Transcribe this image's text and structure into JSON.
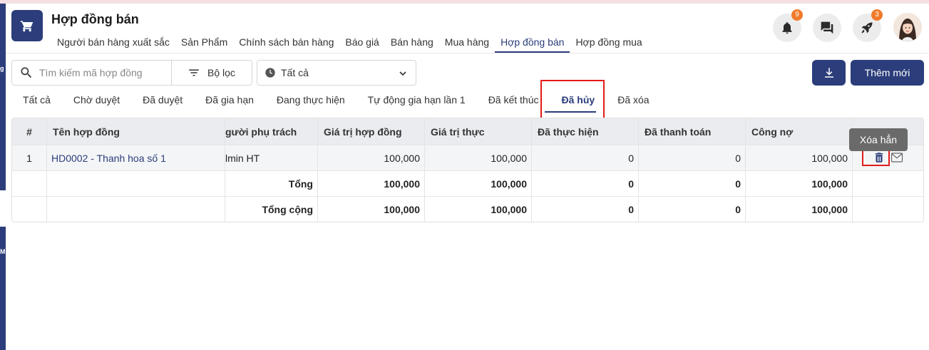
{
  "app": {
    "title": "Hợp đồng bán",
    "icon": "cart-icon"
  },
  "nav": {
    "items": [
      {
        "label": "Người bán hàng xuất sắc"
      },
      {
        "label": "Sản Phẩm"
      },
      {
        "label": "Chính sách bán hàng"
      },
      {
        "label": "Báo giá"
      },
      {
        "label": "Bán hàng"
      },
      {
        "label": "Mua hàng"
      },
      {
        "label": "Hợp đồng bán",
        "active": true
      },
      {
        "label": "Hợp đồng mua"
      }
    ]
  },
  "header_actions": {
    "notifications_badge": "9",
    "rocket_badge": "3"
  },
  "toolbar": {
    "search_placeholder": "Tìm kiếm mã hợp đồng",
    "filter_label": "Bộ lọc",
    "status_value": "Tất cả",
    "add_label": "Thêm mới"
  },
  "status_tabs": [
    {
      "label": "Tất cả"
    },
    {
      "label": "Chờ duyệt"
    },
    {
      "label": "Đã duyệt"
    },
    {
      "label": "Đã gia hạn"
    },
    {
      "label": "Đang thực hiện"
    },
    {
      "label": "Tự động gia hạn lần 1"
    },
    {
      "label": "Đã kết thúc"
    },
    {
      "label": "Đã hủy",
      "active": true
    },
    {
      "label": "Đã xóa"
    }
  ],
  "table": {
    "columns": [
      "#",
      "Tên hợp đồng",
      "gười phụ trách",
      "Giá trị hợp đồng",
      "Giá trị thực",
      "Đã thực hiện",
      "Đã thanh toán",
      "Công nợ"
    ],
    "rows": [
      {
        "index": "1",
        "name": "HD0002 - Thanh hoa số 1",
        "owner": "lmin HT",
        "contract_value": "100,000",
        "actual_value": "100,000",
        "executed": "0",
        "paid": "0",
        "debt": "100,000"
      }
    ],
    "subtotal": {
      "label": "Tổng",
      "contract_value": "100,000",
      "actual_value": "100,000",
      "executed": "0",
      "paid": "0",
      "debt": "100,000"
    },
    "grand_total": {
      "label": "Tổng cộng",
      "contract_value": "100,000",
      "actual_value": "100,000",
      "executed": "0",
      "paid": "0",
      "debt": "100,000"
    }
  },
  "tooltip": {
    "text": "Xóa hẳn"
  },
  "sidebar_fragments": {
    "letter_g": "g",
    "letter_m": "M"
  },
  "colors": {
    "primary": "#2b3d7a",
    "badge": "#f07a2a",
    "highlight": "#e21b1b"
  }
}
